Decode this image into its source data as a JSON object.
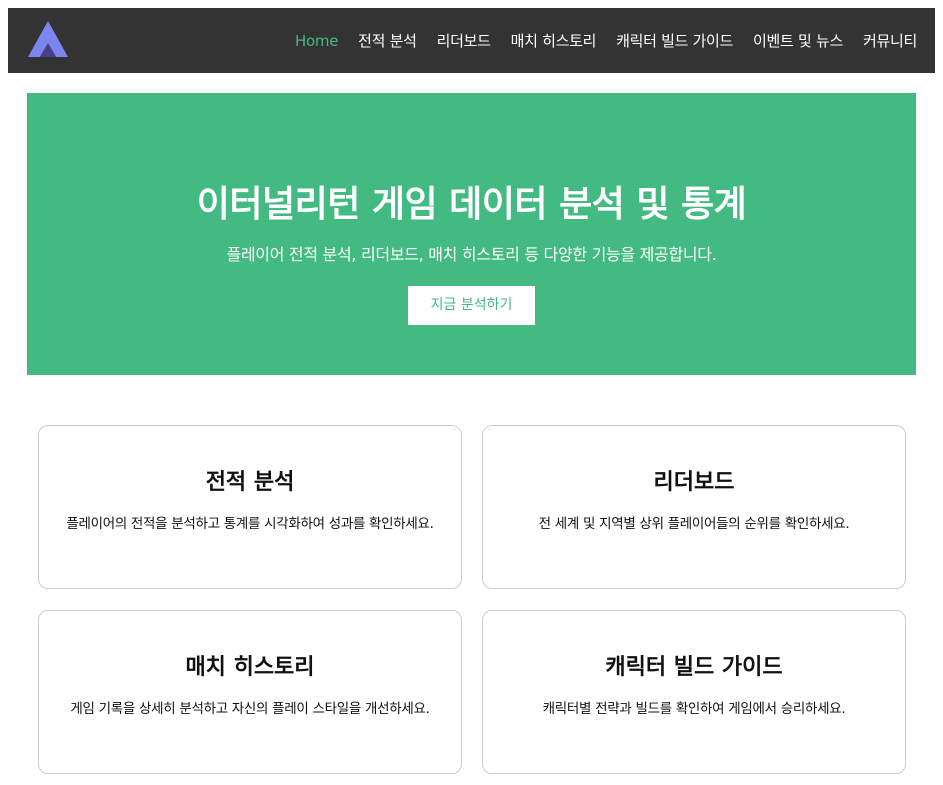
{
  "nav": {
    "logo_icon": "triangle-logo-icon",
    "items": [
      {
        "label": "Home",
        "active": true
      },
      {
        "label": "전적 분석",
        "active": false
      },
      {
        "label": "리더보드",
        "active": false
      },
      {
        "label": "매치 히스토리",
        "active": false
      },
      {
        "label": "캐릭터 빌드 가이드",
        "active": false
      },
      {
        "label": "이벤트 및 뉴스",
        "active": false
      },
      {
        "label": "커뮤니티",
        "active": false
      }
    ]
  },
  "hero": {
    "title": "이터널리턴 게임 데이터 분석 및 통계",
    "subtitle": "플레이어 전적 분석, 리더보드, 매치 히스토리 등 다양한 기능을 제공합니다.",
    "button_label": "지금 분석하기"
  },
  "cards": [
    {
      "title": "전적 분석",
      "description": "플레이어의 전적을 분석하고 통계를 시각화하여 성과를 확인하세요."
    },
    {
      "title": "리더보드",
      "description": "전 세계 및 지역별 상위 플레이어들의 순위를 확인하세요."
    },
    {
      "title": "매치 히스토리",
      "description": "게임 기록을 상세히 분석하고 자신의 플레이 스타일을 개선하세요."
    },
    {
      "title": "캐릭터 빌드 가이드",
      "description": "캐릭터별 전략과 빌드를 확인하여 게임에서 승리하세요."
    }
  ],
  "colors": {
    "accent": "#43ba82",
    "navbar_bg": "#333333",
    "logo_light": "#7b86f0",
    "logo_dark": "#4a3f8a"
  }
}
